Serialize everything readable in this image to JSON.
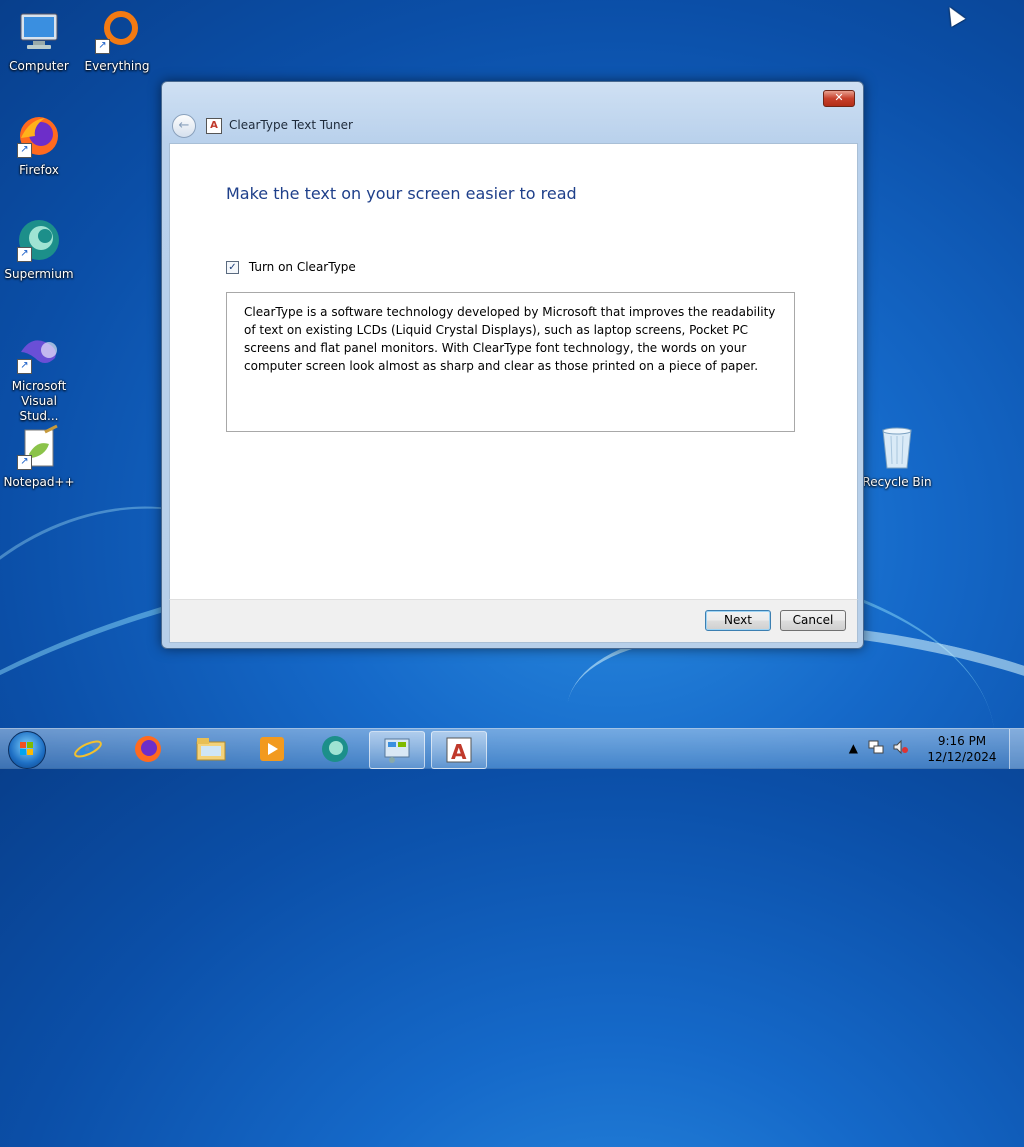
{
  "desktop": {
    "icons": [
      {
        "label": "Computer"
      },
      {
        "label": "Everything"
      },
      {
        "label": "Firefox"
      },
      {
        "label": "Supermium"
      },
      {
        "label": "Microsoft Visual Stud..."
      },
      {
        "label": "Notepad++"
      },
      {
        "label": "Recycle Bin"
      }
    ]
  },
  "window": {
    "title": "ClearType Text Tuner",
    "close_label": "✕",
    "heading": "Make the text on your screen easier to read",
    "checkbox_label": "Turn on ClearType",
    "checkbox_checked": true,
    "description": "ClearType is a software technology developed by Microsoft that improves the readability of text on existing LCDs (Liquid Crystal Displays), such as laptop screens, Pocket PC screens and flat panel monitors. With ClearType font technology, the words on your computer screen look almost as sharp and clear as those printed on a piece of paper.",
    "next_label": "Next",
    "cancel_label": "Cancel"
  },
  "taskbar": {
    "items": [
      {
        "icon": "internet-explorer-icon"
      },
      {
        "icon": "firefox-icon"
      },
      {
        "icon": "file-explorer-icon"
      },
      {
        "icon": "media-player-icon"
      },
      {
        "icon": "supermium-icon"
      },
      {
        "icon": "control-panel-icon"
      },
      {
        "icon": "cleartype-icon"
      }
    ],
    "clock": {
      "time": "9:16 PM",
      "date": "12/12/2024"
    }
  },
  "colors": {
    "heading": "#1e3f8a",
    "desktop": "#1569c9"
  }
}
